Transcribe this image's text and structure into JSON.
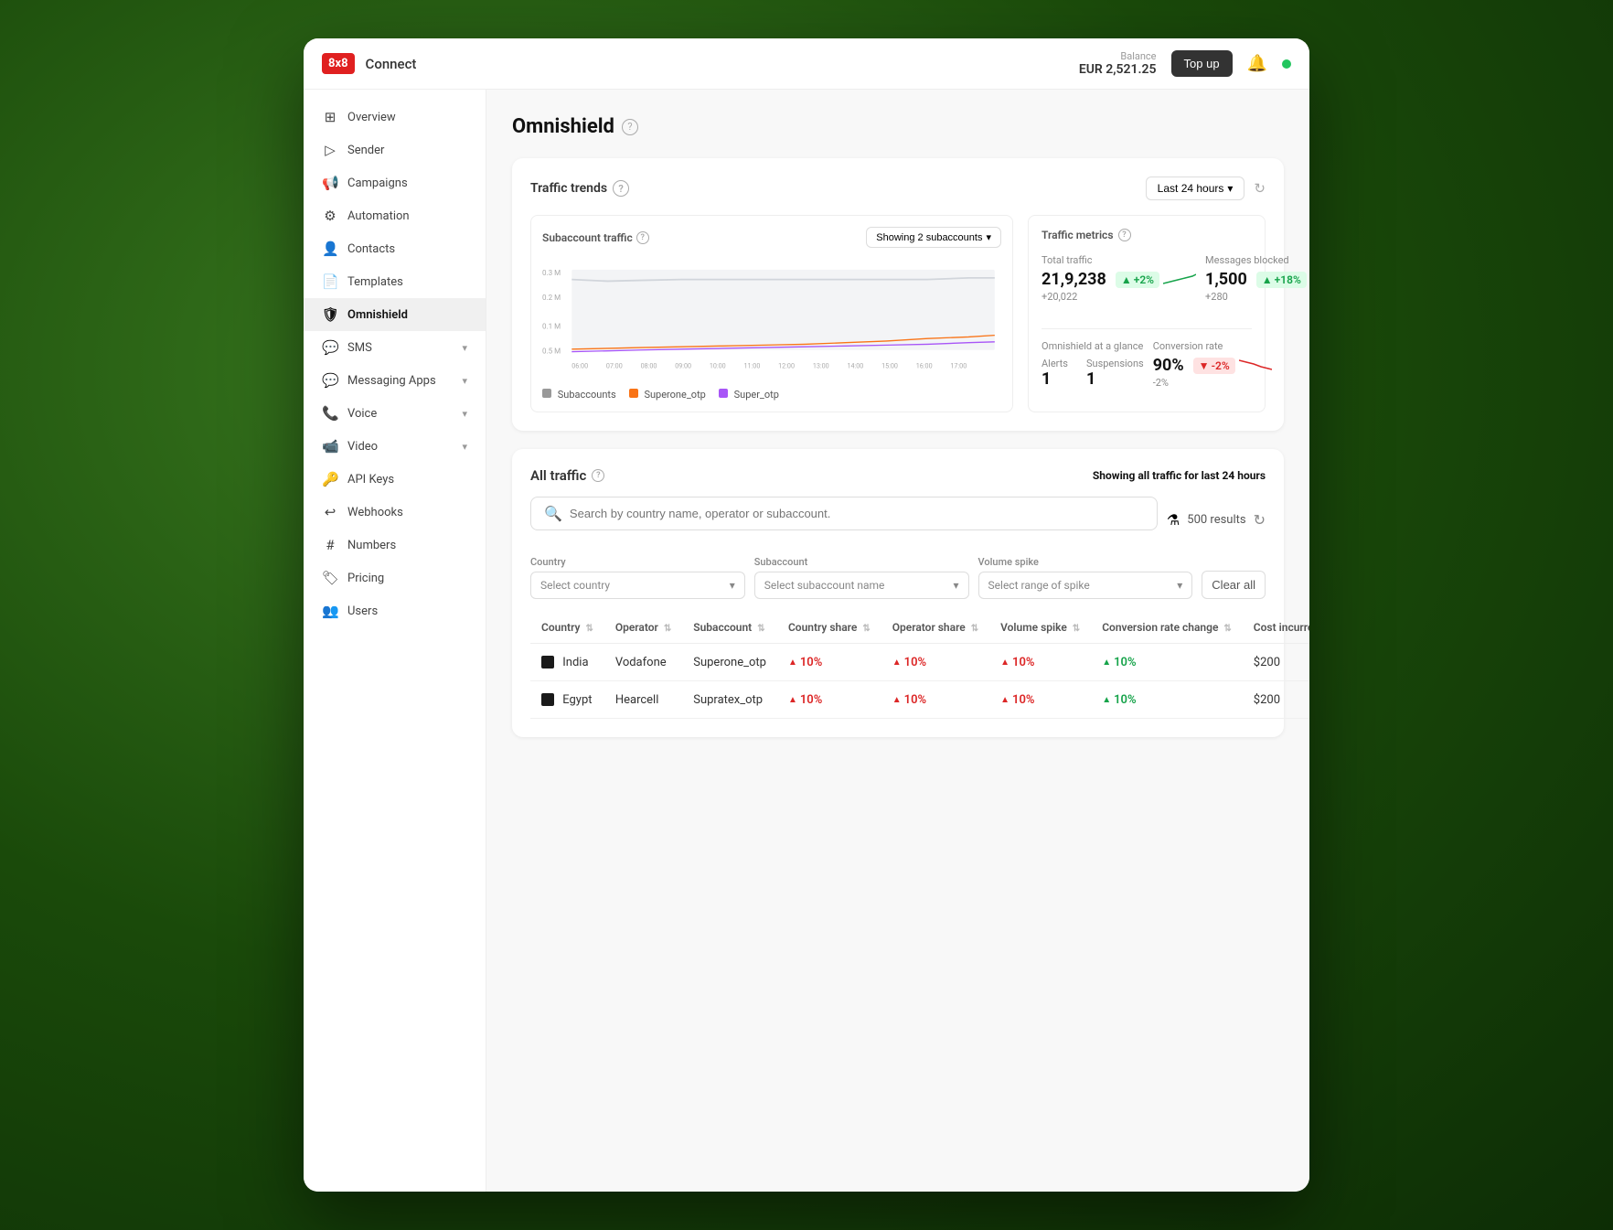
{
  "app": {
    "logo": "8x8",
    "name": "Connect",
    "balance_label": "Balance",
    "balance_value": "EUR 2,521.25",
    "top_up_label": "Top up"
  },
  "sidebar": {
    "items": [
      {
        "id": "overview",
        "label": "Overview",
        "icon": "⊞",
        "active": false,
        "expandable": false
      },
      {
        "id": "sender",
        "label": "Sender",
        "icon": "▷",
        "active": false,
        "expandable": false
      },
      {
        "id": "campaigns",
        "label": "Campaigns",
        "icon": "📢",
        "active": false,
        "expandable": false
      },
      {
        "id": "automation",
        "label": "Automation",
        "icon": "⚙",
        "active": false,
        "expandable": false
      },
      {
        "id": "contacts",
        "label": "Contacts",
        "icon": "👤",
        "active": false,
        "expandable": false
      },
      {
        "id": "templates",
        "label": "Templates",
        "icon": "📄",
        "active": false,
        "expandable": false
      },
      {
        "id": "omnishield",
        "label": "Omnishield",
        "icon": "🛡",
        "active": true,
        "expandable": false
      },
      {
        "id": "sms",
        "label": "SMS",
        "icon": "💬",
        "active": false,
        "expandable": true
      },
      {
        "id": "messaging-apps",
        "label": "Messaging Apps",
        "icon": "💬",
        "active": false,
        "expandable": true
      },
      {
        "id": "voice",
        "label": "Voice",
        "icon": "📞",
        "active": false,
        "expandable": true
      },
      {
        "id": "video",
        "label": "Video",
        "icon": "📹",
        "active": false,
        "expandable": true
      },
      {
        "id": "api-keys",
        "label": "API Keys",
        "icon": "🔑",
        "active": false,
        "expandable": false
      },
      {
        "id": "webhooks",
        "label": "Webhooks",
        "icon": "↩",
        "active": false,
        "expandable": false
      },
      {
        "id": "numbers",
        "label": "Numbers",
        "icon": "#",
        "active": false,
        "expandable": false
      },
      {
        "id": "pricing",
        "label": "Pricing",
        "icon": "🏷",
        "active": false,
        "expandable": false
      },
      {
        "id": "users",
        "label": "Users",
        "icon": "👥",
        "active": false,
        "expandable": false
      }
    ]
  },
  "page": {
    "title": "Omnishield"
  },
  "traffic_trends": {
    "title": "Traffic trends",
    "time_filter": "Last 24 hours",
    "subaccount_traffic_label": "Subaccount traffic",
    "showing_label": "Showing 2 subaccounts",
    "y_axis": [
      "0.3 M",
      "0.2 M",
      "0.1 M",
      "0.5 M"
    ],
    "x_axis": [
      "06:00",
      "07:00",
      "08:00",
      "09:00",
      "10:00",
      "11:00",
      "12:00",
      "13:00",
      "14:00",
      "15:00",
      "16:00",
      "17:00"
    ],
    "legend": [
      {
        "label": "Subaccounts",
        "color": "#999"
      },
      {
        "label": "Superone_otp",
        "color": "#f97316"
      },
      {
        "label": "Super_otp",
        "color": "#a855f7"
      }
    ]
  },
  "traffic_metrics": {
    "title": "Traffic metrics",
    "total_traffic": {
      "label": "Total traffic",
      "value": "21,9,238",
      "value_display": "21,9,238",
      "sub": "+20,022",
      "badge": "+2%",
      "badge_type": "up"
    },
    "messages_blocked": {
      "label": "Messages blocked",
      "value": "1,500",
      "sub": "+280",
      "badge": "+18%",
      "badge_type": "up"
    },
    "omnishield_glance": {
      "label": "Omnishield at a glance",
      "alerts_label": "Alerts",
      "alerts_value": "1",
      "suspensions_label": "Suspensions",
      "suspensions_value": "1"
    },
    "conversion_rate": {
      "label": "Conversion rate",
      "value": "90%",
      "sub": "-2%",
      "badge": "-2%",
      "badge_type": "down"
    }
  },
  "all_traffic": {
    "title": "All traffic",
    "subtitle": "Showing all traffic for last",
    "subtitle_bold": "24",
    "subtitle_end": "hours",
    "search_placeholder": "Search by country name, operator or subaccount.",
    "results_count": "500 results",
    "filters": {
      "country": {
        "label": "Country",
        "placeholder": "Select country"
      },
      "subaccount": {
        "label": "Subaccount",
        "placeholder": "Select subaccount name"
      },
      "volume_spike": {
        "label": "Volume spike",
        "placeholder": "Select range of spike"
      },
      "clear_all": "Clear all"
    },
    "table": {
      "columns": [
        {
          "key": "country",
          "label": "Country"
        },
        {
          "key": "operator",
          "label": "Operator"
        },
        {
          "key": "subaccount",
          "label": "Subaccount"
        },
        {
          "key": "country_share",
          "label": "Country share"
        },
        {
          "key": "operator_share",
          "label": "Operator share"
        },
        {
          "key": "volume_spike",
          "label": "Volume spike"
        },
        {
          "key": "conversion_rate_change",
          "label": "Conversion rate change"
        },
        {
          "key": "cost_incurred",
          "label": "Cost incurred"
        }
      ],
      "rows": [
        {
          "country": "India",
          "flag_color": "#333",
          "operator": "Vodafone",
          "subaccount": "Superone_otp",
          "country_share": "10%",
          "country_share_dir": "up",
          "operator_share": "10%",
          "operator_share_dir": "up",
          "volume_spike": "10%",
          "volume_spike_dir": "up",
          "conversion_rate_change": "10%",
          "conversion_dir": "up_green",
          "cost_incurred": "$200"
        },
        {
          "country": "Egypt",
          "flag_color": "#333",
          "operator": "Hearcell",
          "subaccount": "Supratex_otp",
          "country_share": "10%",
          "country_share_dir": "up",
          "operator_share": "10%",
          "operator_share_dir": "up",
          "volume_spike": "10%",
          "volume_spike_dir": "up",
          "conversion_rate_change": "10%",
          "conversion_dir": "up_green",
          "cost_incurred": "$200"
        }
      ]
    }
  }
}
